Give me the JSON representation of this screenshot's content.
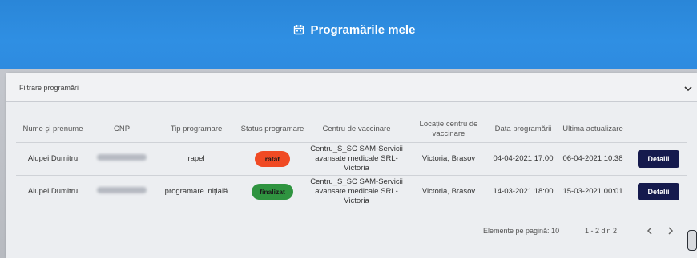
{
  "header": {
    "title": "Programările mele",
    "accent": "#2e8be0"
  },
  "filter": {
    "label": "Filtrare programări"
  },
  "table": {
    "columns": [
      "Nume și prenume",
      "CNP",
      "Tip programare",
      "Status programare",
      "Centru de vaccinare",
      "Locație centru de vaccinare",
      "Data programării",
      "Ultima actualizare",
      ""
    ],
    "rows": [
      {
        "name": "Alupei Dumitru",
        "tip": "rapel",
        "status": "ratat",
        "centru": "Centru_S_SC SAM-Servicii avansate medicale SRL- Victoria",
        "locatie": "Victoria, Brasov",
        "data": "04-04-2021 17:00",
        "actualizare": "06-04-2021 10:38",
        "action": "Detalii"
      },
      {
        "name": "Alupei Dumitru",
        "tip": "programare inițială",
        "status": "finalizat",
        "centru": "Centru_S_SC SAM-Servicii avansate medicale SRL- Victoria",
        "locatie": "Victoria, Brasov",
        "data": "14-03-2021 18:00",
        "actualizare": "15-03-2021 00:01",
        "action": "Detalii"
      }
    ]
  },
  "pager": {
    "per_page_label": "Elemente pe pagină: 10",
    "range": "1 - 2 din 2"
  },
  "icons": {
    "title": "calendar-icon",
    "filter": "chevron-down-icon",
    "prev": "chevron-left-icon",
    "next": "chevron-right-icon"
  },
  "colors": {
    "status_ratat": "#f04a24",
    "status_finalizat": "#2f9440",
    "button": "#151a4d"
  }
}
